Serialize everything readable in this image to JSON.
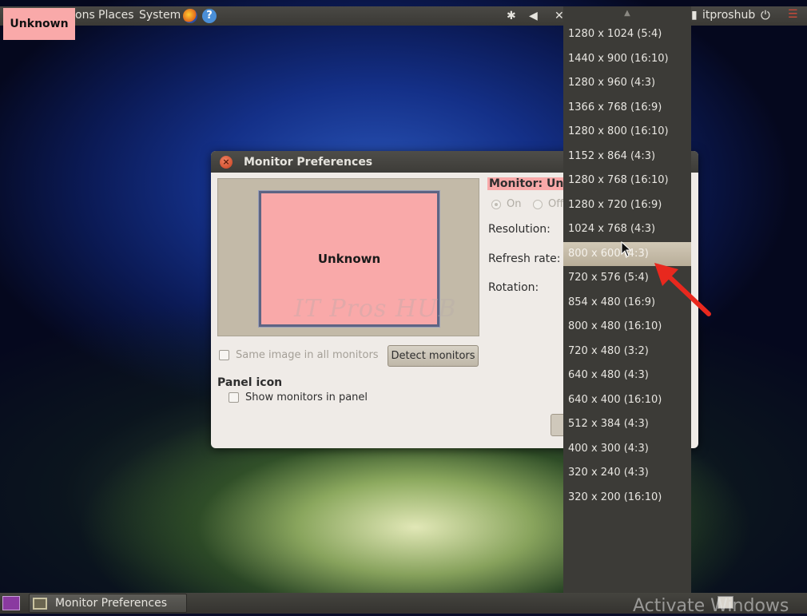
{
  "top_panel": {
    "menu_applications_fragment": "ons",
    "menu_places": "Places",
    "menu_system": "System",
    "help_glyph": "?",
    "user_name": "itproshub",
    "icons": [
      "firefox-icon",
      "help-icon",
      "bluetooth-icon",
      "volume-icon",
      "power-icon",
      "network-icon"
    ]
  },
  "unknown_tag": "Unknown",
  "dialog": {
    "title": "Monitor Preferences",
    "monitor_box_label": "Unknown",
    "watermark": "IT Pros HUB",
    "same_image_label": "Same image in all monitors",
    "detect_button": "Detect monitors",
    "panel_icon_heading": "Panel icon",
    "show_monitors_label": "Show monitors in panel",
    "monitor_label": "Monitor: Unk",
    "radio_on": "On",
    "radio_off": "Off",
    "resolution_label": "Resolution:",
    "refresh_rate_label": "Refresh rate:",
    "rotation_label": "Rotation:"
  },
  "resolution_dropdown": {
    "selected_index": 9,
    "items": [
      "1280 x 1024 (5:4)",
      "1440 x 900 (16:10)",
      "1280 x 960 (4:3)",
      "1366 x 768 (16:9)",
      "1280 x 800 (16:10)",
      "1152 x 864 (4:3)",
      "1280 x 768 (16:10)",
      "1280 x 720 (16:9)",
      "1024 x 768 (4:3)",
      "800 x 600 (4:3)",
      "720 x 576 (5:4)",
      "854 x 480 (16:9)",
      "800 x 480 (16:10)",
      "720 x 480 (3:2)",
      "640 x 480 (4:3)",
      "640 x 400 (16:10)",
      "512 x 384 (4:3)",
      "400 x 300 (4:3)",
      "320 x 240 (4:3)",
      "320 x 200 (16:10)"
    ]
  },
  "bottom_panel": {
    "task_label": "Monitor Preferences",
    "activate_text": "Activate Windows"
  },
  "colors": {
    "panel": "#3c3b37",
    "dialog_bg": "#efebe7",
    "monitor_pink": "#f9a9a9",
    "highlight": "#c9bfab",
    "arrow_red": "#e8281e"
  }
}
